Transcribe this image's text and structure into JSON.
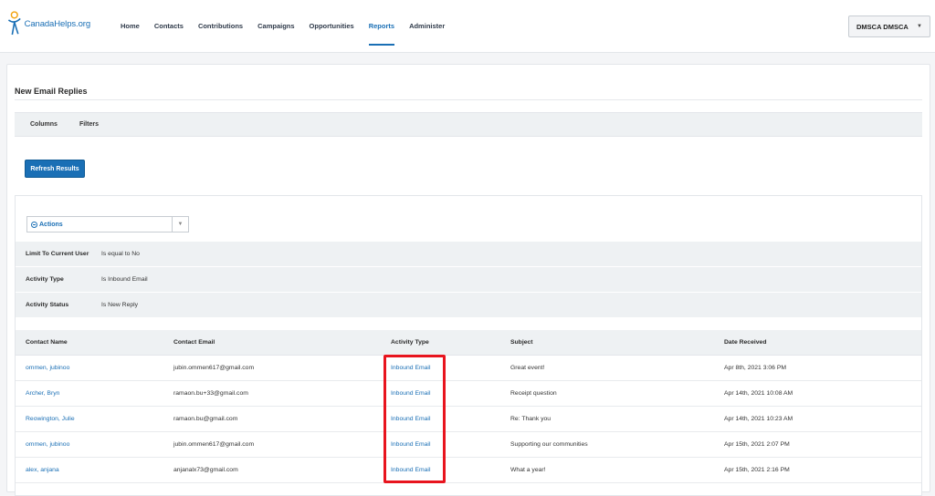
{
  "header": {
    "logo_text": "CanadaHelps.org",
    "nav": [
      {
        "label": "Home",
        "active": false
      },
      {
        "label": "Contacts",
        "active": false
      },
      {
        "label": "Contributions",
        "active": false
      },
      {
        "label": "Campaigns",
        "active": false
      },
      {
        "label": "Opportunities",
        "active": false
      },
      {
        "label": "Reports",
        "active": true
      },
      {
        "label": "Administer",
        "active": false
      }
    ],
    "user_menu": "DMSCA DMSCA",
    "accent_color": "#1a6fb5"
  },
  "page": {
    "title": "New Email Replies",
    "tabs": [
      "Columns",
      "Filters"
    ],
    "refresh_button": "Refresh Results",
    "actions_label": "Actions"
  },
  "filters": [
    {
      "name": "Limit To Current User",
      "value": "Is equal to No"
    },
    {
      "name": "Activity Type",
      "value": "Is Inbound Email"
    },
    {
      "name": "Activity Status",
      "value": "Is New Reply"
    }
  ],
  "table": {
    "columns": [
      "Contact Name",
      "Contact Email",
      "Activity Type",
      "Subject",
      "Date Received"
    ],
    "rows": [
      {
        "name": "ommen, jubinoo",
        "email": "jubin.ommen617@gmail.com",
        "type": "Inbound Email",
        "subject": "Great event!",
        "date": "Apr 8th, 2021 3:06 PM"
      },
      {
        "name": "Archer, Bryn",
        "email": "ramaon.bu+33@gmail.com",
        "type": "Inbound Email",
        "subject": "Receipt question",
        "date": "Apr 14th, 2021 10:08 AM"
      },
      {
        "name": "Reowington, Julie",
        "email": "ramaon.bu@gmail.com",
        "type": "Inbound Email",
        "subject": "Re: Thank you",
        "date": "Apr 14th, 2021 10:23 AM"
      },
      {
        "name": "ommen, jubinoo",
        "email": "jubin.ommen617@gmail.com",
        "type": "Inbound Email",
        "subject": "Supporting our communities",
        "date": "Apr 15th, 2021 2:07 PM"
      },
      {
        "name": "alex, anjana",
        "email": "anjanalx73@gmail.com",
        "type": "Inbound Email",
        "subject": "What a year!",
        "date": "Apr 15th, 2021 2:16 PM"
      }
    ]
  },
  "annotation": {
    "highlight_color": "#e8141e"
  }
}
